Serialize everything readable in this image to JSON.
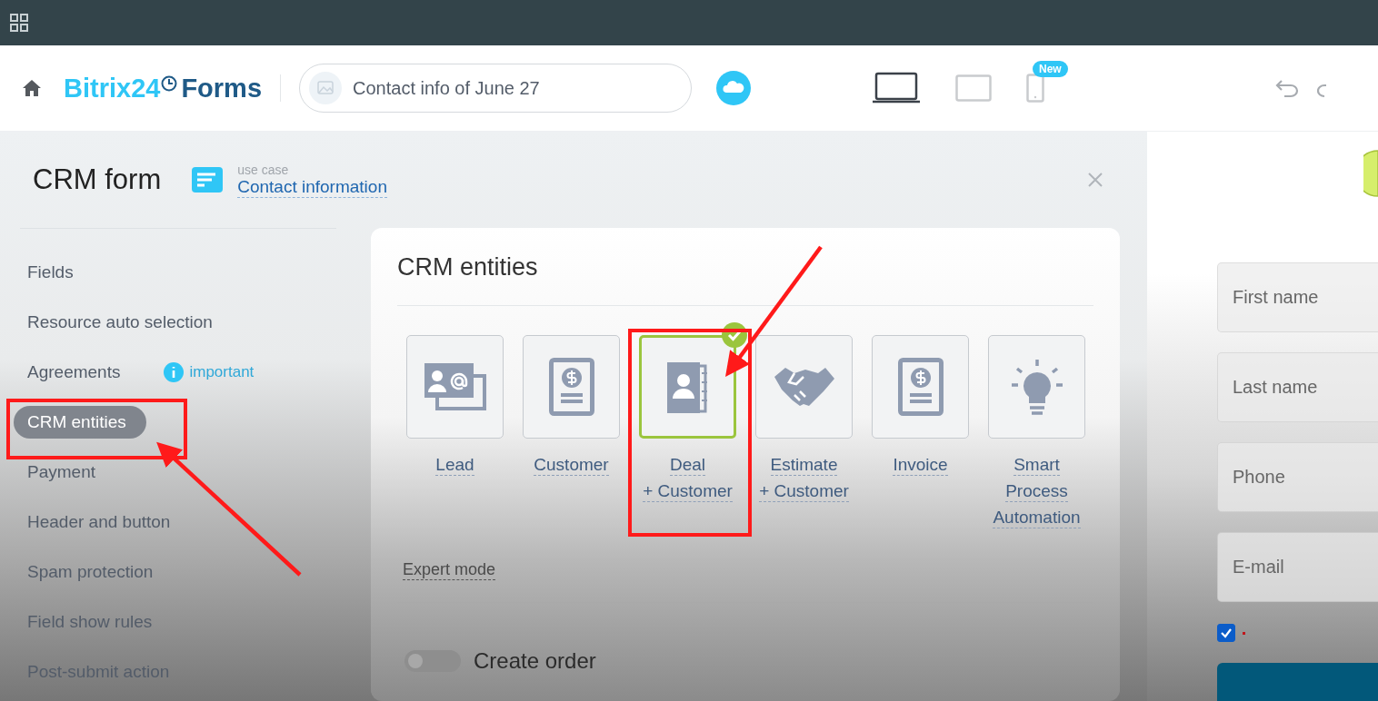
{
  "header": {
    "logo_brand": "Bitrix24",
    "logo_product": "Forms",
    "form_name": "Contact info of June 27",
    "devices": [
      {
        "kind": "laptop",
        "selected": true
      },
      {
        "kind": "tablet",
        "selected": false
      },
      {
        "kind": "phone",
        "selected": false,
        "badge": "New"
      }
    ]
  },
  "panel": {
    "title": "CRM form",
    "use_case_label": "use case",
    "use_case": "Contact information"
  },
  "sidebar": [
    {
      "label": "Fields",
      "selected": false
    },
    {
      "label": "Resource auto selection",
      "selected": false
    },
    {
      "label": "Agreements",
      "selected": false,
      "note": "important"
    },
    {
      "label": "CRM entities",
      "selected": true
    },
    {
      "label": "Payment",
      "selected": false
    },
    {
      "label": "Header and button",
      "selected": false
    },
    {
      "label": "Spam protection",
      "selected": false
    },
    {
      "label": "Field show rules",
      "selected": false
    },
    {
      "label": "Post-submit action",
      "selected": false
    }
  ],
  "entities": {
    "title": "CRM entities",
    "items": [
      {
        "kind": "lead",
        "lines": [
          "Lead"
        ],
        "selected": false
      },
      {
        "kind": "customer",
        "lines": [
          "Customer"
        ],
        "selected": false
      },
      {
        "kind": "deal",
        "lines": [
          "Deal",
          "+ Customer"
        ],
        "selected": true
      },
      {
        "kind": "estimate",
        "lines": [
          "Estimate",
          "+ Customer"
        ],
        "selected": false
      },
      {
        "kind": "invoice",
        "lines": [
          "Invoice"
        ],
        "selected": false
      },
      {
        "kind": "automation",
        "lines": [
          "Smart",
          "Process",
          "Automation"
        ],
        "selected": false
      }
    ],
    "expert_mode": "Expert mode",
    "create_order": {
      "label": "Create order",
      "on": false
    }
  },
  "preview": {
    "fields": [
      {
        "placeholder": "First name"
      },
      {
        "placeholder": "Last name"
      },
      {
        "placeholder": "Phone"
      },
      {
        "placeholder": "E-mail"
      }
    ],
    "consent_checked": true
  }
}
